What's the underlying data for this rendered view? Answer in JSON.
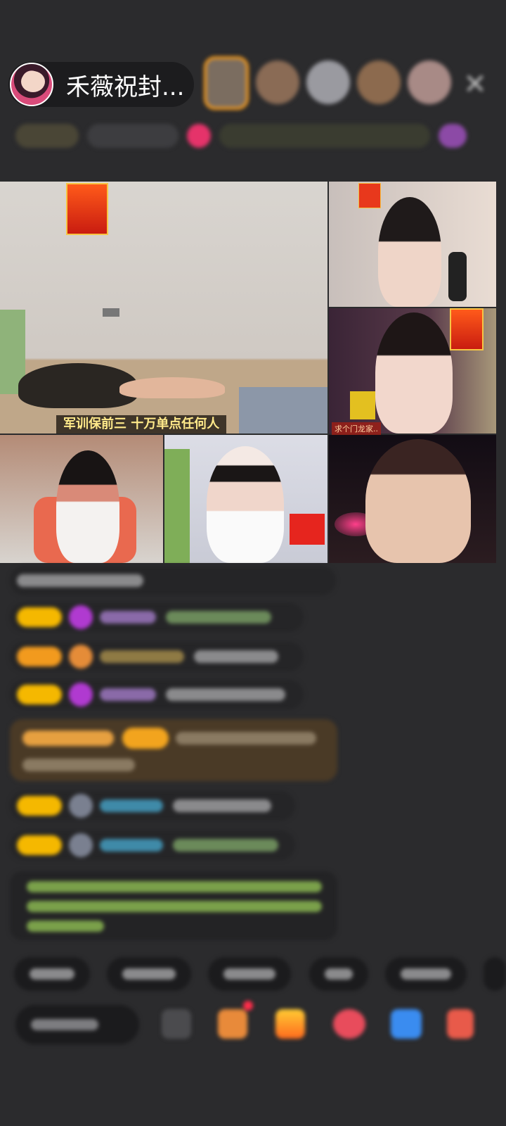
{
  "header": {
    "host_name": "禾薇祝封...",
    "close_icon": "close-icon"
  },
  "video": {
    "main_caption": "军训保前三  十万单点任何人",
    "small_tag": "求个门龙家.."
  },
  "colors": {
    "level_badge": "#f5b800",
    "viewer_ring": "#f39a1e",
    "system_message_bg": "#4a3a26",
    "green_text": "#7aa04a"
  }
}
